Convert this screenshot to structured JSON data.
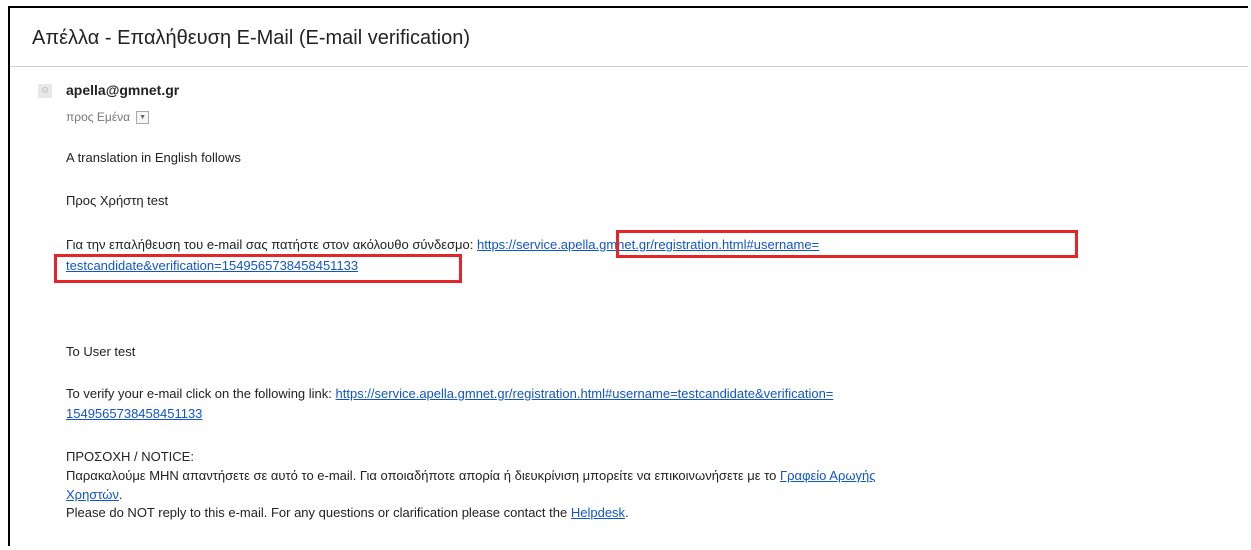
{
  "email": {
    "subject": "Απέλλα - Επαλήθευση E-Mail (E-mail verification)",
    "sender": "apella@gmnet.gr",
    "recipient": "προς Εμένα",
    "body": {
      "intro": "A translation in English follows",
      "greeting_gr": "Προς Χρήστη test",
      "verify_gr_text": "Για την επαλήθευση του e-mail σας πατήστε στον ακόλουθο σύνδεσμο:",
      "verify_gr_link_1": "https://service.apella.gmnet.gr/registration.html#username=",
      "verify_gr_link_2": "testcandidate&verification=1549565738458451133",
      "greeting_en": "To User test",
      "verify_en_text": "To verify your e-mail click on the following link:",
      "verify_en_link_1": "https://service.apella.gmnet.gr/registration.html#username=testcandidate&verification=",
      "verify_en_link_2": "1549565738458451133",
      "notice_title": "ΠΡΟΣΟΧΗ / NOTICE:",
      "notice_gr_text": "Παρακαλούμε ΜΗΝ απαντήσετε σε αυτό το e-mail. Για οποιαδήποτε απορία ή διευκρίνιση μπορείτε να επικοινωνήσετε με το",
      "notice_gr_link_1": "Γραφείο Αρωγής",
      "notice_gr_link_2": "Χρηστών",
      "notice_gr_end": ".",
      "notice_en_text": "Please do NOT reply to this e-mail. For any questions or clarification please contact the",
      "notice_en_link": "Helpdesk",
      "notice_en_end": "."
    }
  },
  "highlight_color": "#e4262b",
  "link_color": "#1155cc",
  "icons": {
    "avatar": "person-icon",
    "recipient_menu": "dropdown-icon"
  }
}
